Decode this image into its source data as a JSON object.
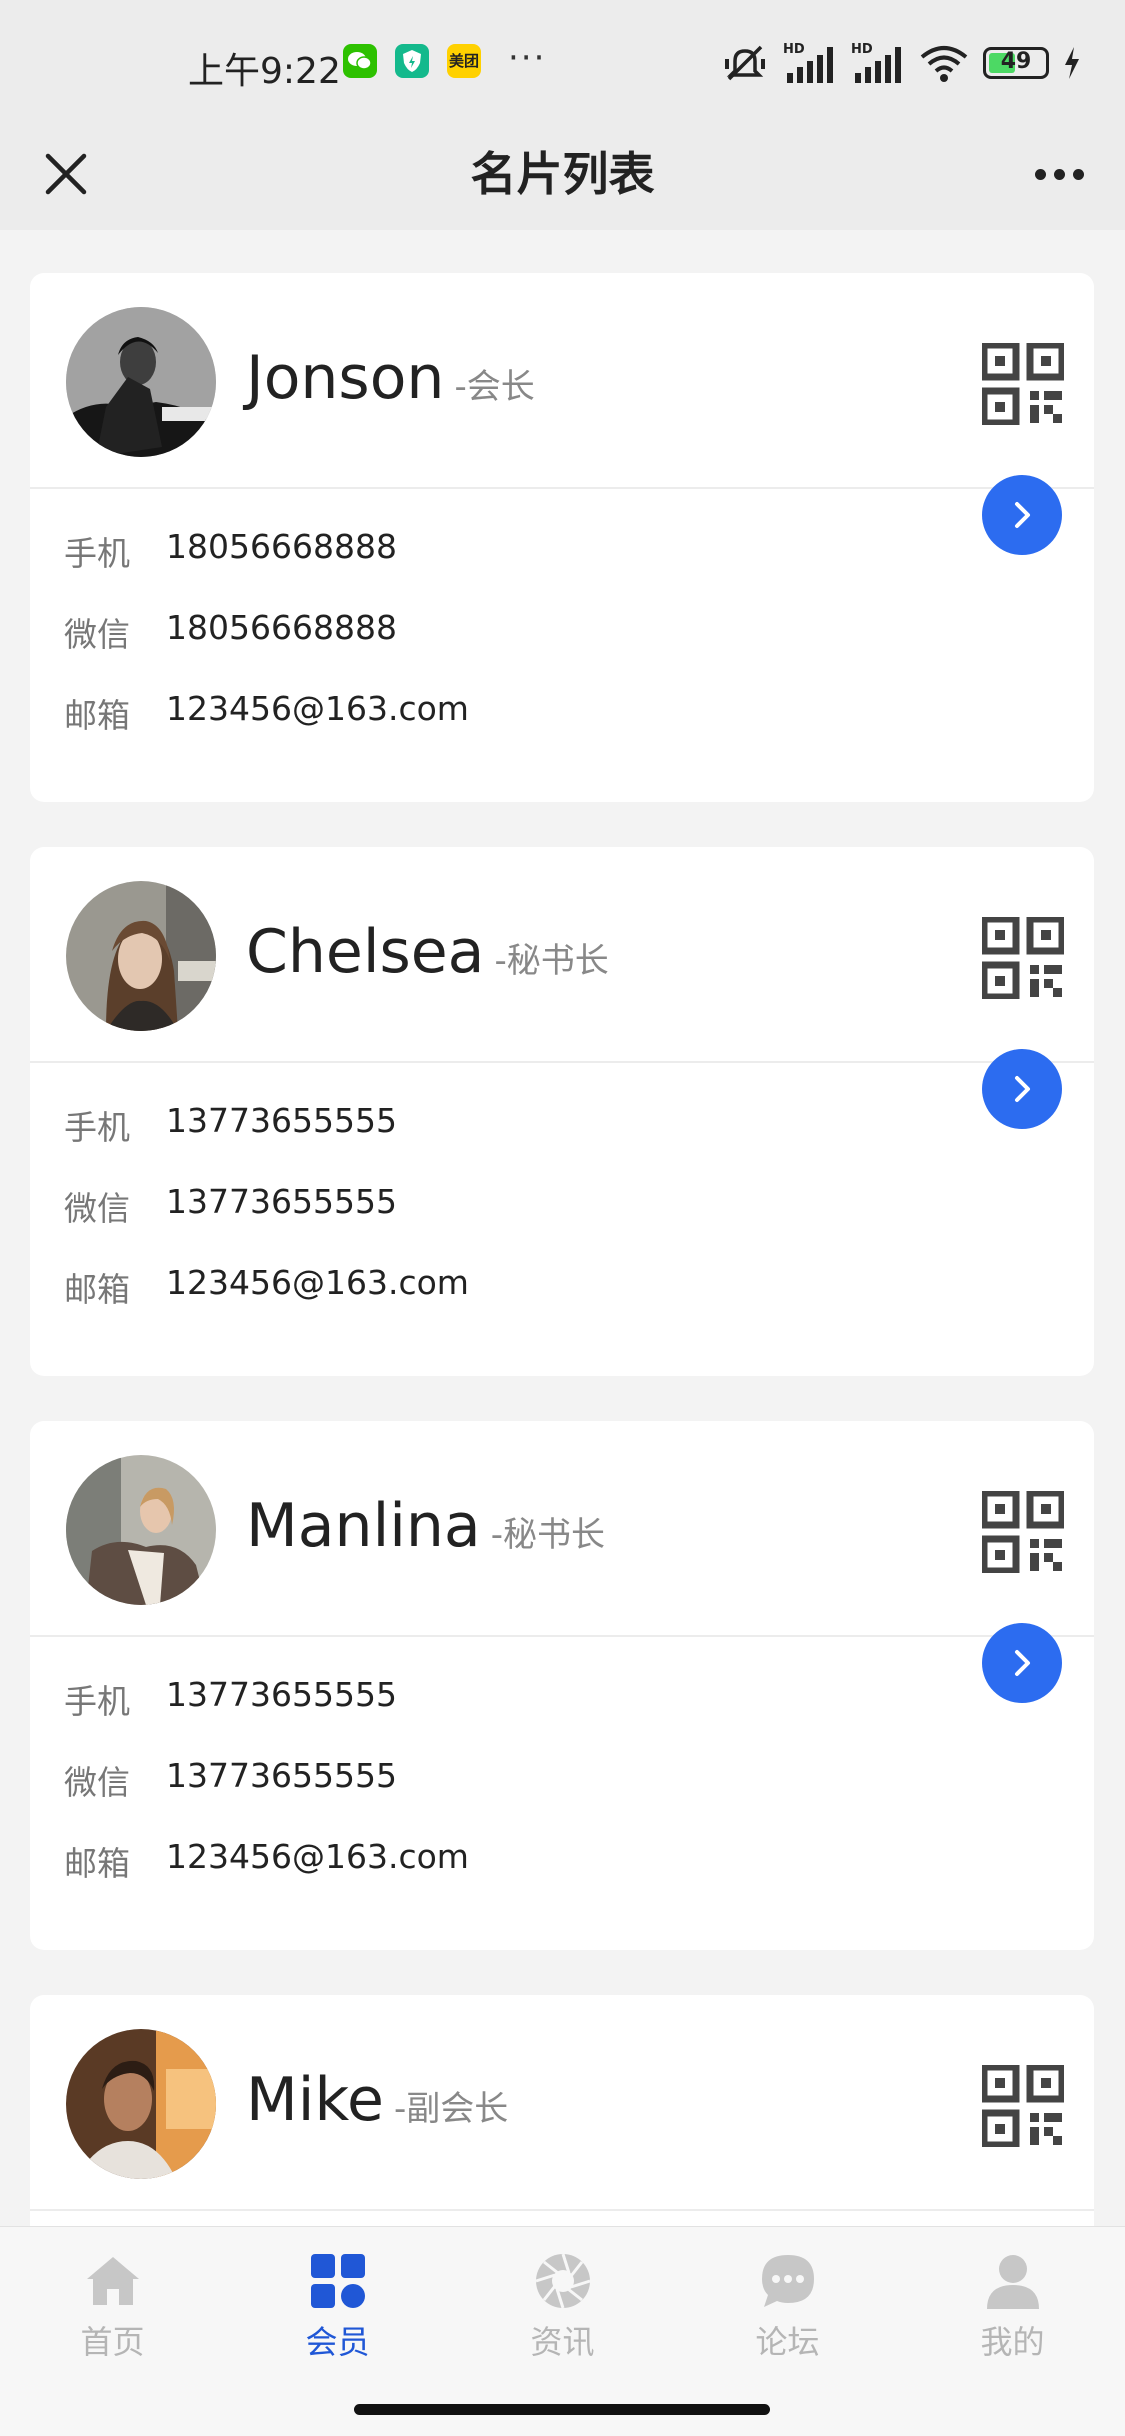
{
  "status_bar": {
    "time": "上午9:22",
    "apps": [
      "wechat-icon",
      "shield-icon",
      "meituan-icon"
    ],
    "meituan_label": "美团",
    "more": "···",
    "battery_level": "49",
    "signal_labels": [
      "HD",
      "HD"
    ]
  },
  "nav": {
    "title": "名片列表"
  },
  "labels": {
    "phone": "手机",
    "wechat": "微信",
    "email": "邮箱"
  },
  "cards": [
    {
      "name": "Jonson",
      "title": "-会长",
      "phone": "18056668888",
      "wechat": "18056668888",
      "email": "123456@163.com"
    },
    {
      "name": "Chelsea",
      "title": "-秘书长",
      "phone": "13773655555",
      "wechat": "13773655555",
      "email": "123456@163.com"
    },
    {
      "name": "Manlina",
      "title": "-秘书长",
      "phone": "13773655555",
      "wechat": "13773655555",
      "email": "123456@163.com"
    },
    {
      "name": "Mike",
      "title": "-副会长"
    }
  ],
  "tabs": [
    {
      "label": "首页",
      "icon": "home-icon",
      "active": false
    },
    {
      "label": "会员",
      "icon": "grid-icon",
      "active": true
    },
    {
      "label": "资讯",
      "icon": "aperture-icon",
      "active": false
    },
    {
      "label": "论坛",
      "icon": "chat-bubble-icon",
      "active": false
    },
    {
      "label": "我的",
      "icon": "user-icon",
      "active": false
    }
  ],
  "colors": {
    "accent": "#2c6cf0",
    "tab_active": "#2057d6",
    "tab_inactive": "#b5b5b5",
    "background": "#f3f3f3"
  }
}
